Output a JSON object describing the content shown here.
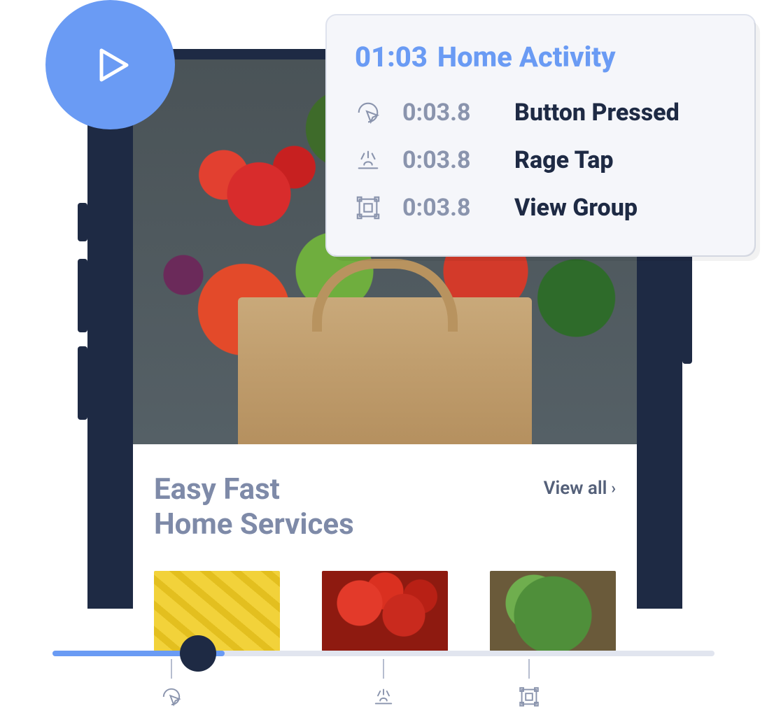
{
  "colors": {
    "accent": "#6a9bf4",
    "dark": "#1e2a44",
    "muted": "#8a94ad"
  },
  "panel": {
    "timestamp": "01:03",
    "title": "Home Activity",
    "events": [
      {
        "icon": "cursor-click-icon",
        "time": "0:03.8",
        "label": "Button Pressed"
      },
      {
        "icon": "rage-tap-icon",
        "time": "0:03.8",
        "label": "Rage Tap"
      },
      {
        "icon": "view-group-icon",
        "time": "0:03.8",
        "label": "View Group"
      }
    ]
  },
  "app": {
    "section_title_line1": "Easy Fast",
    "section_title_line2": "Home Services",
    "view_all_label": "View all",
    "products": [
      {
        "name": "bananas"
      },
      {
        "name": "tomatoes"
      },
      {
        "name": "spinach"
      }
    ]
  },
  "timeline": {
    "progress_percent": 26,
    "markers": [
      {
        "icon": "cursor-click-icon"
      },
      {
        "icon": "rage-tap-icon"
      },
      {
        "icon": "view-group-icon"
      }
    ]
  }
}
